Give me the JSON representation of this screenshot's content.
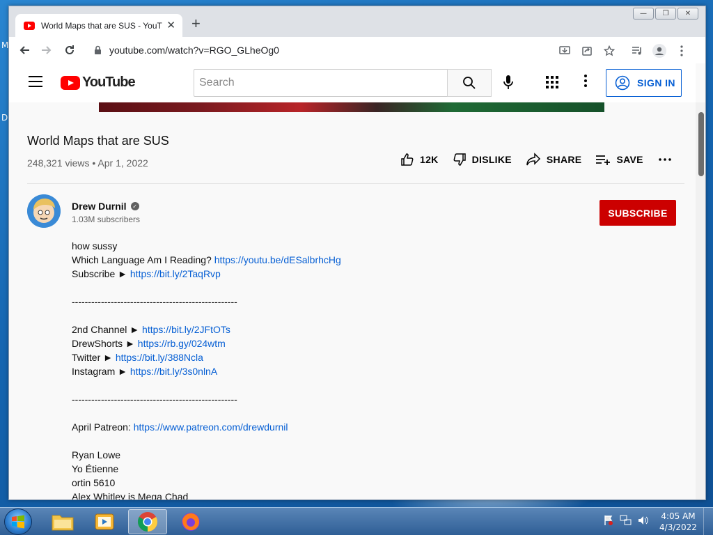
{
  "desktop": {
    "edge_top": "M",
    "edge_mid": "D"
  },
  "browser": {
    "tab_title": "World Maps that are SUS - YouTube",
    "tab_close": "✕",
    "new_tab": "+",
    "url": "youtube.com/watch?v=RGO_GLheOg0",
    "window_controls": [
      "—",
      "❐",
      "✕"
    ]
  },
  "youtube": {
    "logo_text": "YouTube",
    "search_placeholder": "Search",
    "sign_in": "SIGN IN",
    "video": {
      "title": "World Maps that are SUS",
      "meta": "248,321 views • Apr 1, 2022",
      "likes": "12K",
      "dislike": "DISLIKE",
      "share": "SHARE",
      "save": "SAVE"
    },
    "channel": {
      "name": "Drew Durnil",
      "subscribers": "1.03M subscribers",
      "subscribe": "SUBSCRIBE"
    },
    "description": [
      {
        "text": "how sussy",
        "link": ""
      },
      {
        "text": "Which Language Am I Reading? ",
        "link": "https://youtu.be/dESalbrhcHg"
      },
      {
        "text": "Subscribe ► ",
        "link": "https://bit.ly/2TaqRvp"
      },
      {
        "text": "",
        "link": ""
      },
      {
        "text": "---------------------------------------------------",
        "link": ""
      },
      {
        "text": "",
        "link": ""
      },
      {
        "text": "2nd Channel ► ",
        "link": "https://bit.ly/2JFtOTs"
      },
      {
        "text": "DrewShorts ► ",
        "link": "https://rb.gy/024wtm"
      },
      {
        "text": "Twitter ► ",
        "link": "https://bit.ly/388Ncla"
      },
      {
        "text": "Instagram ► ",
        "link": "https://bit.ly/3s0nlnA"
      },
      {
        "text": "",
        "link": ""
      },
      {
        "text": "---------------------------------------------------",
        "link": ""
      },
      {
        "text": "",
        "link": ""
      },
      {
        "text": "April Patreon:  ",
        "link": "https://www.patreon.com/drewdurnil"
      },
      {
        "text": "",
        "link": ""
      },
      {
        "text": "Ryan Lowe",
        "link": ""
      },
      {
        "text": "Yo Étienne",
        "link": ""
      },
      {
        "text": "ortin 5610",
        "link": ""
      },
      {
        "text": "Alex Whitley is Mega Chad",
        "link": ""
      }
    ]
  },
  "taskbar": {
    "time": "4:05 AM",
    "date": "4/3/2022",
    "apps": [
      "file-explorer",
      "media-player",
      "chrome",
      "firefox"
    ]
  },
  "colors": {
    "youtube_red": "#ff0000",
    "subscribe_red": "#cc0000",
    "link_blue": "#065fd4"
  }
}
